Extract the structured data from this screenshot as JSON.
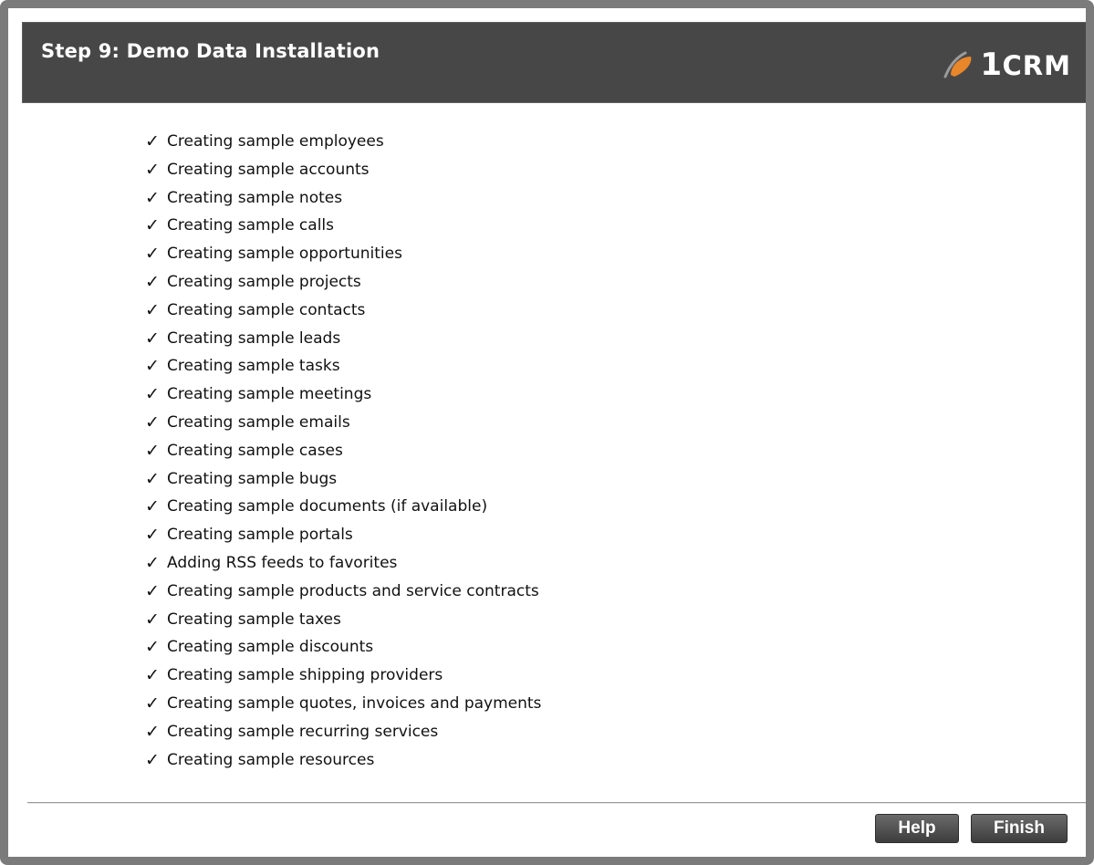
{
  "header": {
    "title": "Step 9: Demo Data Installation",
    "logo_text_number": "1",
    "logo_text_crm": "CRM",
    "logo_icon": "orange-swoosh-icon",
    "brand_color": "#e8862a"
  },
  "steps": [
    {
      "check": "✓",
      "label": "Creating sample employees"
    },
    {
      "check": "✓",
      "label": "Creating sample accounts"
    },
    {
      "check": "✓",
      "label": "Creating sample notes"
    },
    {
      "check": "✓",
      "label": "Creating sample calls"
    },
    {
      "check": "✓",
      "label": "Creating sample opportunities"
    },
    {
      "check": "✓",
      "label": "Creating sample projects"
    },
    {
      "check": "✓",
      "label": "Creating sample contacts"
    },
    {
      "check": "✓",
      "label": "Creating sample leads"
    },
    {
      "check": "✓",
      "label": "Creating sample tasks"
    },
    {
      "check": "✓",
      "label": "Creating sample meetings"
    },
    {
      "check": "✓",
      "label": "Creating sample emails"
    },
    {
      "check": "✓",
      "label": "Creating sample cases"
    },
    {
      "check": "✓",
      "label": "Creating sample bugs"
    },
    {
      "check": "✓",
      "label": "Creating sample documents (if available)"
    },
    {
      "check": "✓",
      "label": "Creating sample portals"
    },
    {
      "check": "✓",
      "label": "Adding RSS feeds to favorites"
    },
    {
      "check": "✓",
      "label": "Creating sample products and service contracts"
    },
    {
      "check": "✓",
      "label": "Creating sample taxes"
    },
    {
      "check": "✓",
      "label": "Creating sample discounts"
    },
    {
      "check": "✓",
      "label": "Creating sample shipping providers"
    },
    {
      "check": "✓",
      "label": "Creating sample quotes, invoices and payments"
    },
    {
      "check": "✓",
      "label": "Creating sample recurring services"
    },
    {
      "check": "✓",
      "label": "Creating sample resources"
    }
  ],
  "footer": {
    "help_label": "Help",
    "finish_label": "Finish"
  }
}
